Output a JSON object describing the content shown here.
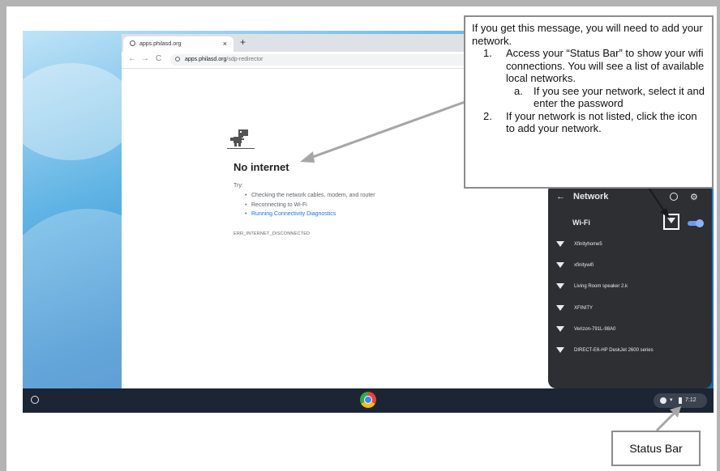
{
  "browser": {
    "tab_title": "apps.philasd.org",
    "tab_close": "×",
    "new_tab": "+",
    "nav_back": "←",
    "nav_forward": "→",
    "nav_reload": "C",
    "address_host": "apps.philasd.org",
    "address_path": "/sdp-redirector"
  },
  "error_page": {
    "title": "No internet",
    "try_label": "Try:",
    "suggestions": [
      "Checking the network cables, modem, and router",
      "Reconnecting to Wi-Fi",
      "Running Connectivity Diagnostics"
    ],
    "error_code": "ERR_INTERNET_DISCONNECTED"
  },
  "network_panel": {
    "back": "←",
    "title": "Network",
    "wifi_label": "Wi-Fi",
    "wifi_enabled": true,
    "networks": [
      "Xfinityhome5",
      "xfinitywifi",
      "Living Room speaker 2.k",
      "XFINITY",
      "Verizon-791L-98A0",
      "DIRECT-E6-HP DeskJet 2600 series"
    ]
  },
  "shelf": {
    "time": "7:12"
  },
  "callout": {
    "intro": "If you get this message, you will need to add your network.",
    "steps": [
      {
        "num": "1.",
        "text": "Access your “Status Bar” to show your wifi connections.  You will see a list of available local networks."
      },
      {
        "num": "a.",
        "text": "If you see your network, select it and enter the password"
      },
      {
        "num": "2.",
        "text": "If your network is not listed, click the icon to add your network."
      }
    ]
  },
  "status_label": "Status Bar",
  "colors": {
    "shelf": "#1b2533",
    "panel": "#2d2f33",
    "link": "#1a73e8",
    "toggle": "#8ab4f8"
  }
}
